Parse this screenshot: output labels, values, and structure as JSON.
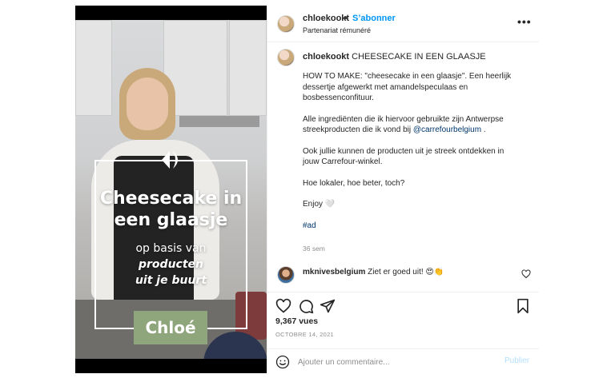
{
  "header": {
    "username": "chloekookt",
    "separator": "•",
    "follow_label": "S’abonner",
    "partnership": "Partenariat rémunéré",
    "more_icon": "more-horizontal-icon"
  },
  "video": {
    "overlay_title": "Cheesecake in een glaasje",
    "overlay_subtitle": "op basis van",
    "overlay_subtitle_em1": "producten",
    "overlay_subtitle_em2": "uit je buurt",
    "name_label": "Chloé",
    "logo_icon": "carrefour-logo-icon",
    "accent_green": "#8fa57c"
  },
  "caption": {
    "username": "chloekookt",
    "headline": "CHEESECAKE IN EEN GLAASJE",
    "p1": "HOW TO MAKE: \"cheesecake in een glaasje\". Een heerlijk dessertje afgewerkt met amandelspeculaas en bosbessenconfituur.",
    "p2_before": "Alle ingrediënten die ik hiervoor gebruikte zijn Antwerpse streekproducten die ik vond bij ",
    "p2_mention": "@carrefourbelgium",
    "p2_after": " .",
    "p3": "Ook jullie kunnen de producten uit je streek ontdekken in jouw Carrefour-winkel.",
    "p4": "Hoe lokaler, hoe beter, toch?",
    "p5": "Enjoy 🤍",
    "hashtag": "#ad",
    "time": "36 sem"
  },
  "comment": {
    "username": "mknivesbelgium",
    "text": "Ziet er goed uit! 😍👏"
  },
  "actions": {
    "views": "9,367 vues",
    "date": "OCTOBRE 14, 2021",
    "comment_placeholder": "Ajouter un commentaire...",
    "post_label": "Publier",
    "link_color": "#0095f6"
  }
}
